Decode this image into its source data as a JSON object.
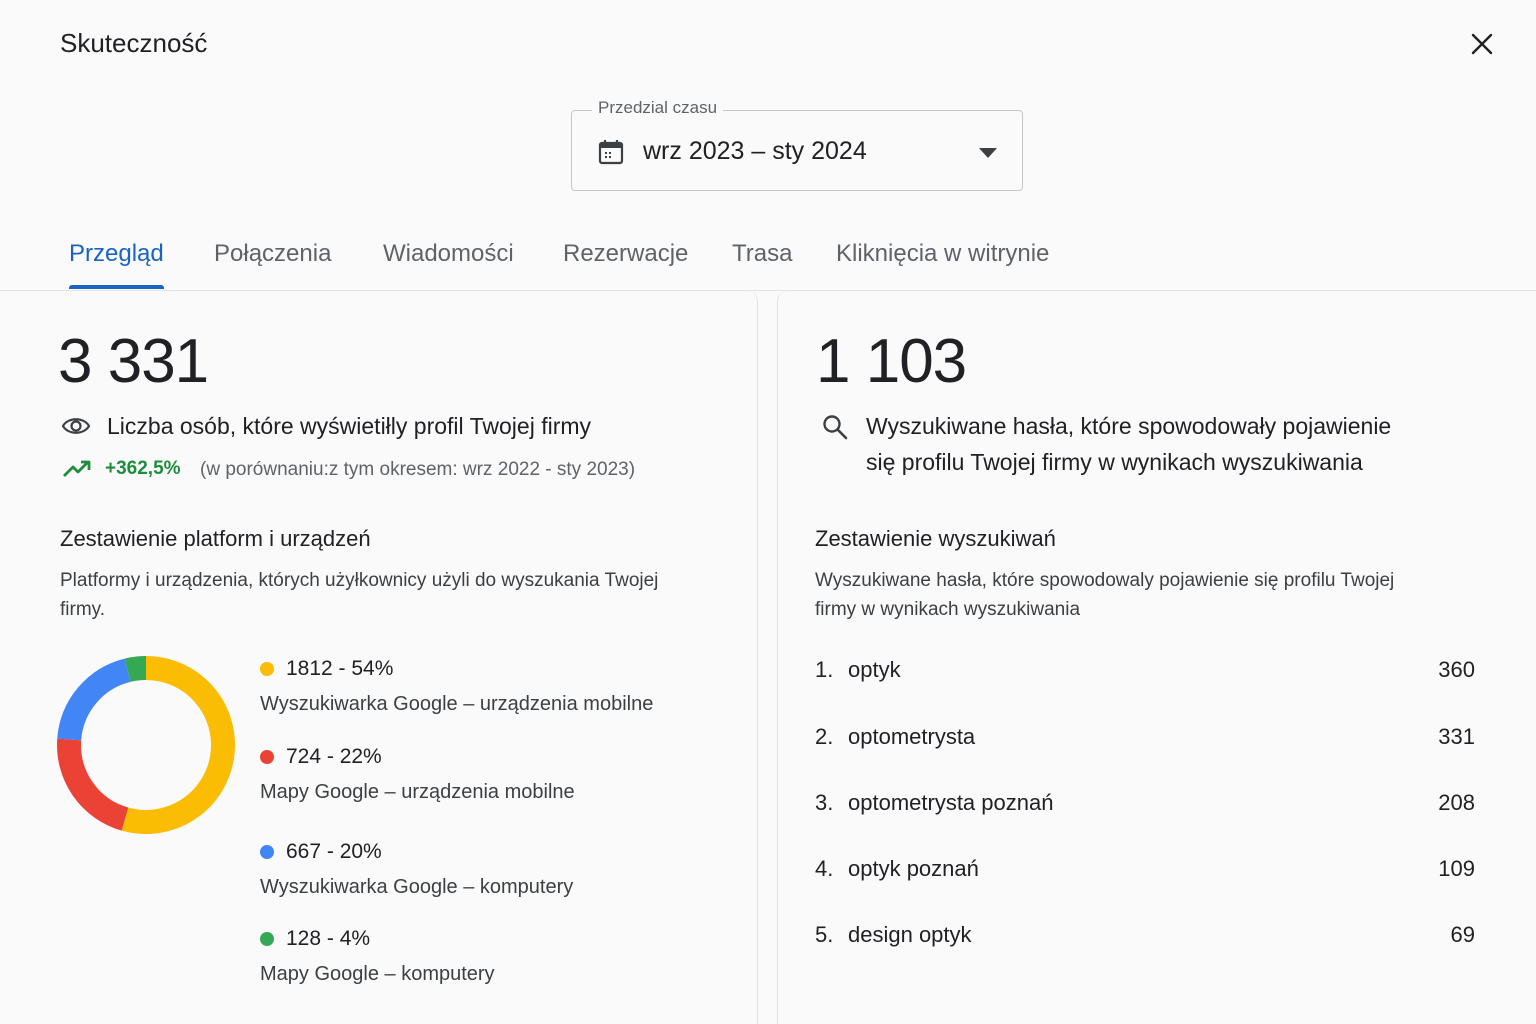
{
  "header": {
    "title": "Skuteczność"
  },
  "range": {
    "legend": "Przedzial czasu",
    "value": "wrz 2023 – sty 2024"
  },
  "tabs": [
    {
      "label": "Przegląd",
      "active": true
    },
    {
      "label": "Połączenia"
    },
    {
      "label": "Wiadomości"
    },
    {
      "label": "Rezerwacje"
    },
    {
      "label": "Trasa"
    },
    {
      "label": "Kliknięcia w witrynie"
    }
  ],
  "left": {
    "big_number": "3 331",
    "label": "Liczba osób, które wyświetiłly profil Twojej firmy",
    "trend_pct": "+362,5%",
    "trend_note": "(w porównaniu:z tym okresem: wrz 2022 - sty 2023)",
    "section_title": "Zestawienie platform i urządzeń",
    "section_desc_1": "Platformy i urządzenia, których użyłkownicy użyli do wyszukania Twojej",
    "section_desc_2": "firmy."
  },
  "right": {
    "big_number": "1 103",
    "label_1": "Wyszukiwane hasła, które spowodowały pojawienie",
    "label_2": "się profilu Twojej firmy w wynikach wyszukiwania",
    "section_title": "Zestawienie wyszukiwań",
    "section_desc_1": "Wyszukiwane hasła, które spowodowaly pojawienie się profilu Twojej",
    "section_desc_2": "firmy w wynikach wyszukiwania",
    "searches": [
      {
        "rank": "1.",
        "term": "optyk",
        "count": "360"
      },
      {
        "rank": "2.",
        "term": "optometrysta",
        "count": "331"
      },
      {
        "rank": "3.",
        "term": "optometrysta poznań",
        "count": "208"
      },
      {
        "rank": "4.",
        "term": "optyk poznań",
        "count": "109"
      },
      {
        "rank": "5.",
        "term": "design optyk",
        "count": "69"
      }
    ]
  },
  "chart_data": {
    "type": "pie",
    "variant": "donut",
    "slices": [
      {
        "value": 1812,
        "percent": 54,
        "label_top": "1812 - 54%",
        "label": "Wyszukiwarka Google – urządzenia mobilne",
        "color": "#fbbc04"
      },
      {
        "value": 724,
        "percent": 22,
        "label_top": "724 - 22%",
        "label": "Mapy Google – urządzenia mobilne",
        "color": "#ea4335"
      },
      {
        "value": 667,
        "percent": 20,
        "label_top": "667 - 20%",
        "label": "Wyszukiwarka Google – komputery",
        "color": "#4285f4"
      },
      {
        "value": 128,
        "percent": 4,
        "label_top": "128 - 4%",
        "label": "Mapy Google – komputery",
        "color": "#34a853"
      }
    ]
  },
  "colors": {
    "accent": "#1a63c2",
    "trend_up": "#1e8e3e"
  },
  "icons": {
    "close": "close-icon",
    "calendar": "calendar-icon",
    "dropdown": "dropdown-caret-icon",
    "views": "eye-icon",
    "trend": "trending-up-icon",
    "search": "search-icon"
  }
}
